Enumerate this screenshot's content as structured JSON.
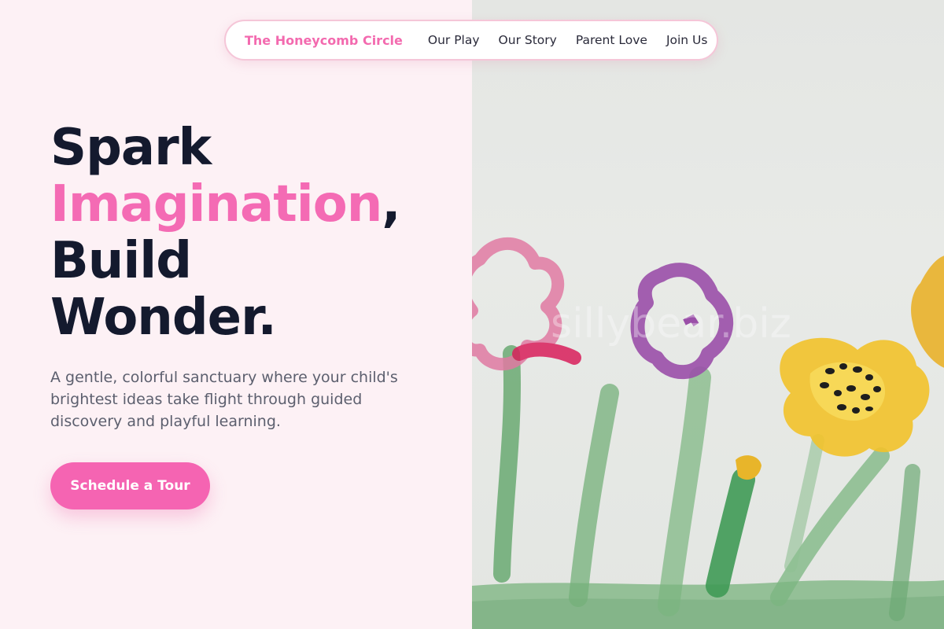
{
  "nav": {
    "brand": "The Honeycomb Circle",
    "links": [
      {
        "label": "Our Play"
      },
      {
        "label": "Our Story"
      },
      {
        "label": "Parent Love"
      },
      {
        "label": "Join Us"
      }
    ]
  },
  "hero": {
    "title_line1": "Spark",
    "title_accent": "Imagination",
    "title_comma": ",",
    "title_line3": "Build",
    "title_line4": "Wonder.",
    "subtitle": "A gentle, colorful sanctuary where your child's brightest ideas take flight through guided discovery and playful learning.",
    "cta_label": "Schedule a Tour"
  },
  "image": {
    "watermark": "sillybear.biz",
    "subject": "children-painting-of-flowers"
  },
  "colors": {
    "accent": "#f46bb4",
    "title": "#141a2e",
    "background": "#fdf1f5",
    "button": "#f564b2"
  }
}
